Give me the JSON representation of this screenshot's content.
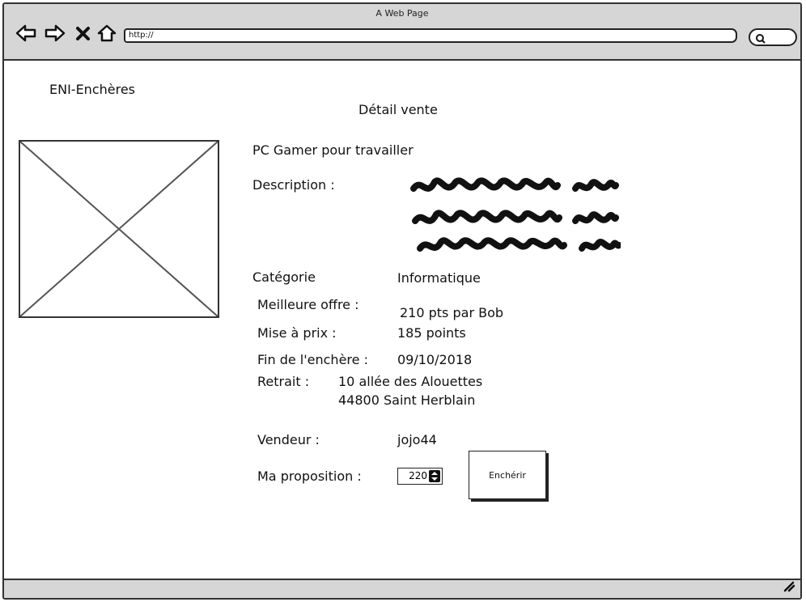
{
  "window": {
    "title": "A Web Page",
    "url": "http://"
  },
  "toolbar": {
    "back_icon": "back-arrow-icon",
    "forward_icon": "forward-arrow-icon",
    "stop_icon": "close-icon",
    "home_icon": "home-icon",
    "search_icon": "search-icon"
  },
  "app": {
    "brand": "ENI-Enchères"
  },
  "page": {
    "title": "Détail vente"
  },
  "item": {
    "name": "PC Gamer pour travailler",
    "description_label": "Description :",
    "category_label": "Catégorie",
    "category_value": "Informatique",
    "best_offer_label": "Meilleure offre :",
    "best_offer_value": "210 pts par Bob",
    "start_price_label": "Mise à prix :",
    "start_price_value": "185 points",
    "end_date_label": "Fin de l'enchère :",
    "end_date_value": "09/10/2018",
    "pickup_label": "Retrait :",
    "pickup_line1": "10 allée des Alouettes",
    "pickup_line2": "44800 Saint Herblain",
    "seller_label": "Vendeur :",
    "seller_value": "jojo44"
  },
  "bid": {
    "label": "Ma proposition :",
    "value": "220",
    "button_label": "Enchérir"
  },
  "colors": {
    "chrome": "#d6d6d6",
    "border": "#333333",
    "ink": "#111111"
  }
}
